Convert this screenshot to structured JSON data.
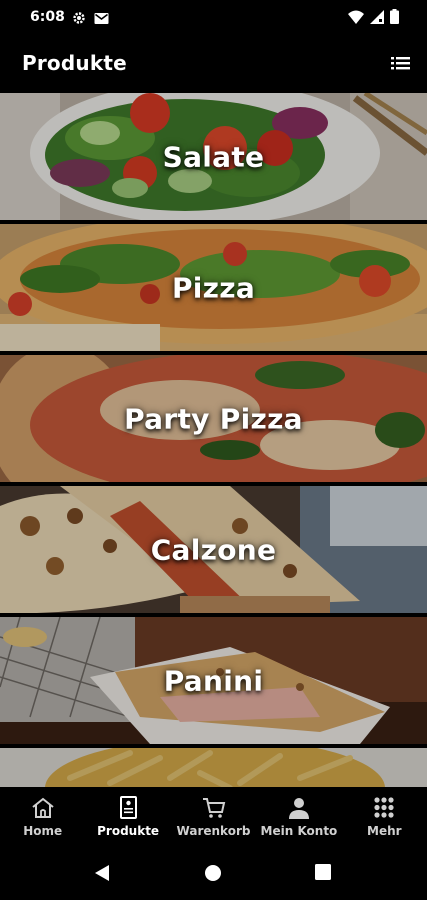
{
  "status_bar": {
    "time": "6:08",
    "left_icons": [
      "settings-icon",
      "mail-icon"
    ],
    "right_icons": [
      "wifi-icon",
      "signal-icon",
      "battery-icon"
    ]
  },
  "app_bar": {
    "title": "Produkte",
    "menu_icon": "list-view-icon"
  },
  "categories": [
    {
      "label": "Salate"
    },
    {
      "label": "Pizza"
    },
    {
      "label": "Party Pizza"
    },
    {
      "label": "Calzone"
    },
    {
      "label": "Panini"
    },
    {
      "label": ""
    }
  ],
  "bottom_nav": {
    "items": [
      {
        "label": "Home",
        "icon": "home-icon"
      },
      {
        "label": "Produkte",
        "icon": "menu-card-icon"
      },
      {
        "label": "Warenkorb",
        "icon": "cart-icon"
      },
      {
        "label": "Mein Konto",
        "icon": "user-icon"
      },
      {
        "label": "Mehr",
        "icon": "grid-icon"
      }
    ],
    "active": "Produkte"
  },
  "system_nav": [
    "back-icon",
    "home-circle-icon",
    "recents-icon"
  ]
}
